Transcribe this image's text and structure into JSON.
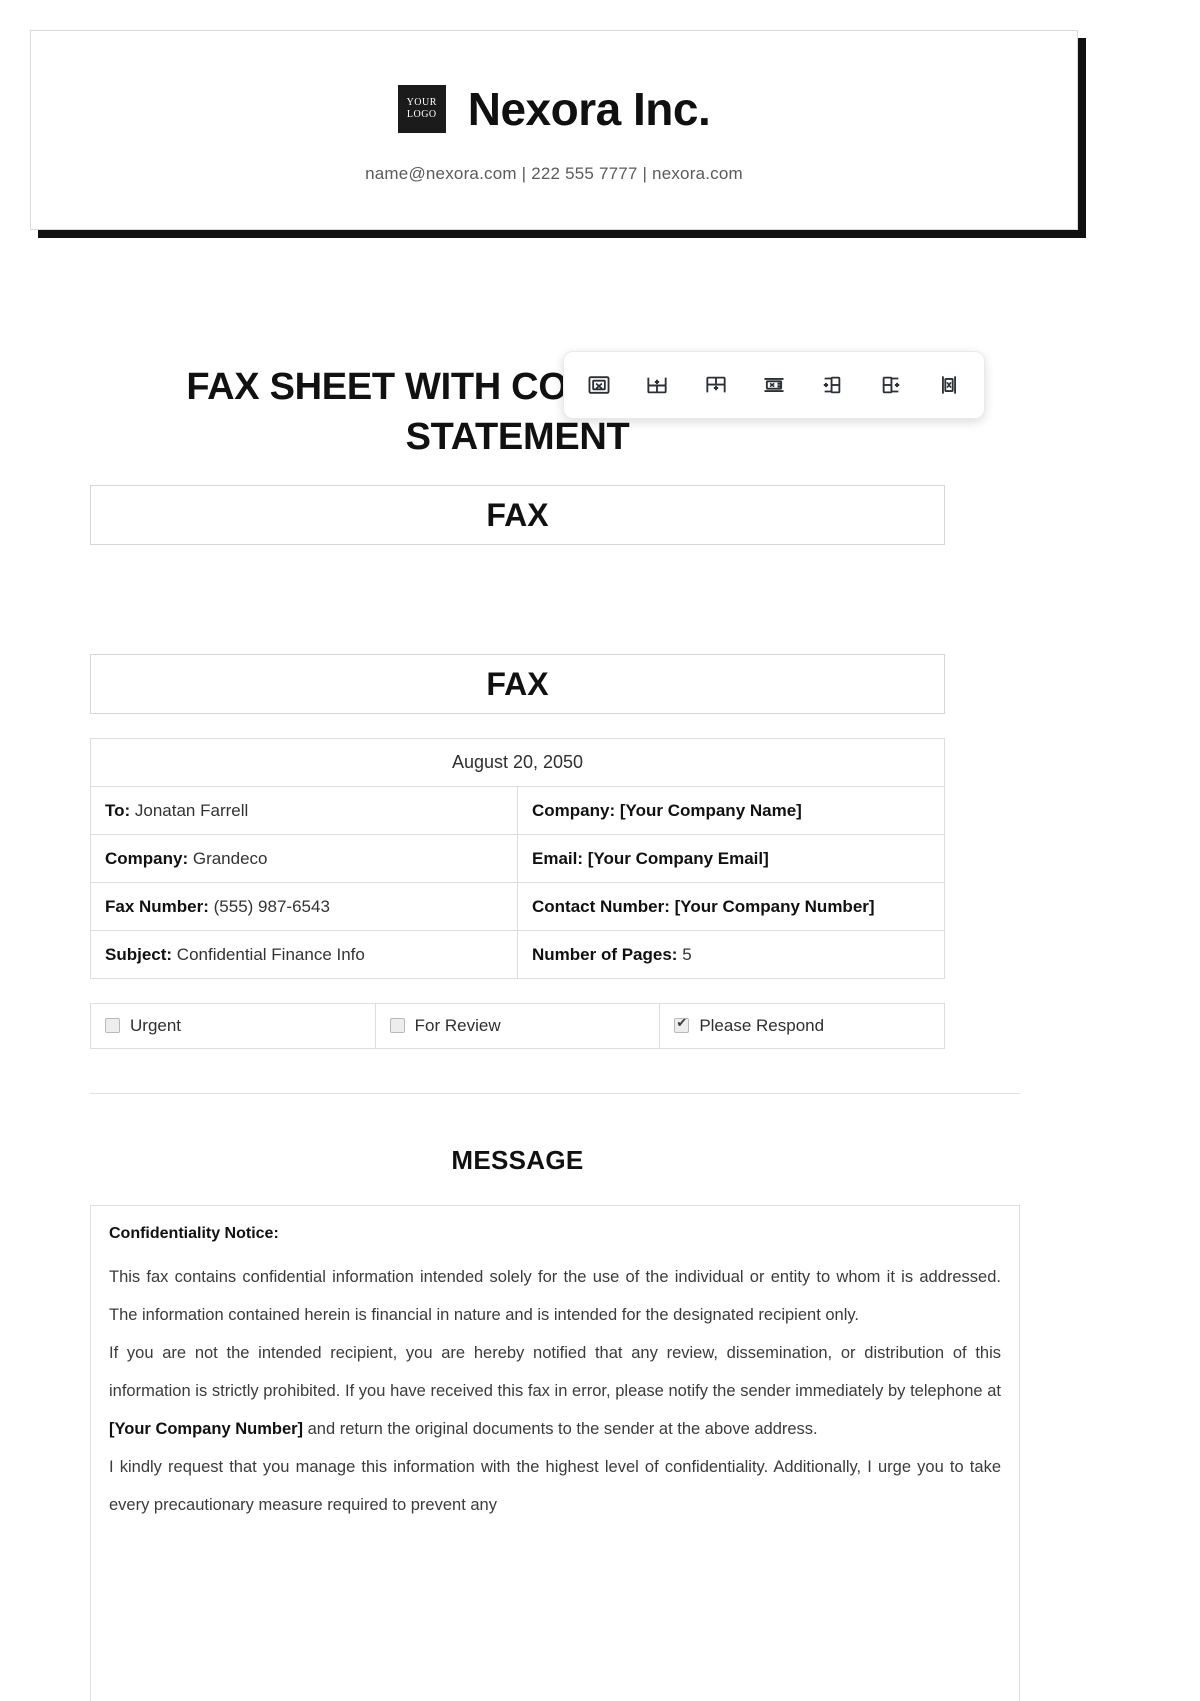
{
  "letterhead": {
    "logo_line1": "YOUR",
    "logo_line2": "LOGO",
    "company_name": "Nexora Inc.",
    "contact_line": "name@nexora.com | 222 555 7777 | nexora.com"
  },
  "document": {
    "title": "FAX SHEET WITH CONFIDENTIALITY STATEMENT",
    "banner_one": "FAX",
    "banner_two": "FAX",
    "message_heading": "MESSAGE"
  },
  "info": {
    "date": "August 20, 2050",
    "rows": [
      {
        "left_label": "To:",
        "left_value": " Jonatan Farrell",
        "right_label": "Company:",
        "right_value": " [Your Company Name]",
        "right_bold": true
      },
      {
        "left_label": "Company:",
        "left_value": " Grandeco",
        "right_label": "Email:",
        "right_value": " [Your Company Email]",
        "right_bold": true
      },
      {
        "left_label": "Fax Number:",
        "left_value": " (555) 987-6543",
        "right_label": "Contact Number:",
        "right_value": " [Your Company Number]",
        "right_bold": true
      },
      {
        "left_label": "Subject:",
        "left_value": " Confidential Finance Info",
        "right_label": "Number of Pages:",
        "right_value": " 5",
        "right_bold": false
      }
    ]
  },
  "checkboxes": [
    {
      "label": "Urgent",
      "checked": false
    },
    {
      "label": "For Review",
      "checked": false
    },
    {
      "label": "Please Respond",
      "checked": true
    }
  ],
  "message": {
    "notice_title": "Confidentiality Notice:",
    "paragraph_1": "This fax contains confidential information intended solely for the use of the individual or entity to whom it is addressed. The information contained herein is financial in nature and is intended for the designated recipient only.",
    "paragraph_2_a": "If you are not the intended recipient, you are hereby notified that any review, dissemination, or distribution of this information is strictly prohibited. If you have received this fax in error, please notify the sender immediately by telephone at ",
    "paragraph_2_bold": "[Your Company Number]",
    "paragraph_2_b": " and return the original documents to the sender at the above address.",
    "paragraph_3": "I kindly request that you manage this information with the highest level of confidentiality. Additionally, I urge you to take every precautionary measure required to prevent any"
  },
  "toolbar": {
    "buttons": [
      {
        "name": "delete-table-icon",
        "title": "Delete table"
      },
      {
        "name": "insert-row-below-icon",
        "title": "Insert row below"
      },
      {
        "name": "insert-row-above-icon",
        "title": "Insert row above"
      },
      {
        "name": "delete-row-icon",
        "title": "Delete row"
      },
      {
        "name": "insert-column-left-icon",
        "title": "Insert column left"
      },
      {
        "name": "insert-column-right-icon",
        "title": "Insert column right"
      },
      {
        "name": "delete-column-icon",
        "title": "Delete column"
      }
    ]
  },
  "colors": {
    "ink": "#111111",
    "muted": "#5b5b5b",
    "border": "#dddddd",
    "logo_bg": "#1b1b1b"
  }
}
